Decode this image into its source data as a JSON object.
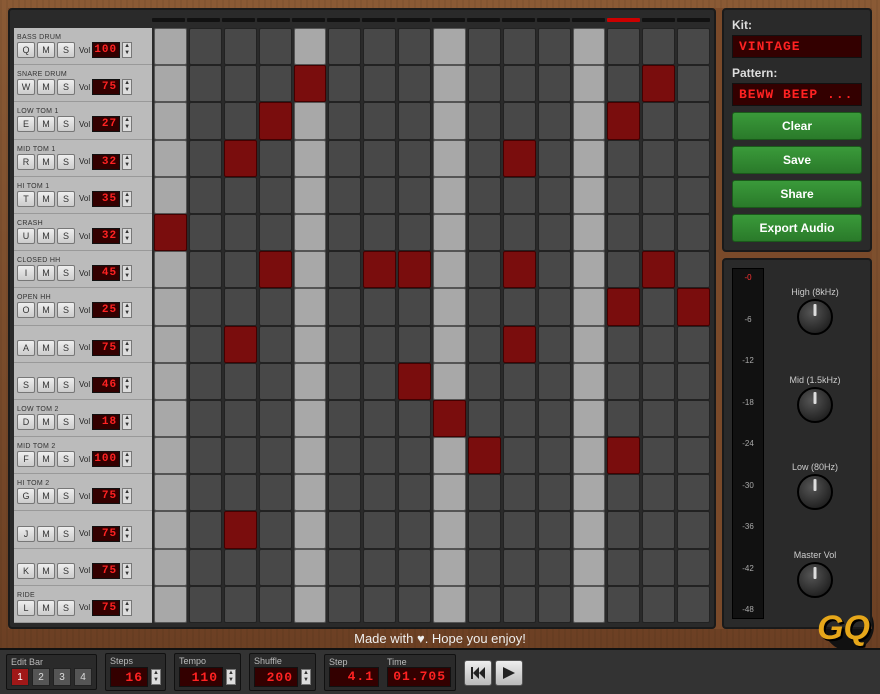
{
  "header_playing_step": 13,
  "tracks": [
    {
      "label": "BASS DRUM",
      "key": "Q",
      "vol": "100",
      "cellsOn": []
    },
    {
      "label": "SNARE DRUM",
      "key": "W",
      "vol": "75",
      "cellsOn": [
        4,
        14
      ]
    },
    {
      "label": "LOW TOM 1",
      "key": "E",
      "vol": "27",
      "cellsOn": [
        3,
        13
      ]
    },
    {
      "label": "MID TOM 1",
      "key": "R",
      "vol": "32",
      "cellsOn": [
        2,
        10
      ]
    },
    {
      "label": "HI TOM 1",
      "key": "T",
      "vol": "35",
      "cellsOn": []
    },
    {
      "label": "CRASH",
      "key": "U",
      "vol": "32",
      "cellsOn": [
        0
      ]
    },
    {
      "label": "CLOSED HH",
      "key": "I",
      "vol": "45",
      "cellsOn": [
        3,
        6,
        7,
        10,
        14
      ]
    },
    {
      "label": "OPEN HH",
      "key": "O",
      "vol": "25",
      "cellsOn": [
        13,
        15
      ]
    },
    {
      "label": "",
      "key": "A",
      "vol": "75",
      "cellsOn": [
        2,
        10
      ]
    },
    {
      "label": "",
      "key": "S",
      "vol": "46",
      "cellsOn": [
        7
      ]
    },
    {
      "label": "LOW TOM 2",
      "key": "D",
      "vol": "18",
      "cellsOn": [
        8
      ]
    },
    {
      "label": "MID TOM 2",
      "key": "F",
      "vol": "100",
      "cellsOn": [
        9,
        13
      ]
    },
    {
      "label": "HI TOM 2",
      "key": "G",
      "vol": "75",
      "cellsOn": []
    },
    {
      "label": "",
      "key": "J",
      "vol": "75",
      "cellsOn": [
        2
      ]
    },
    {
      "label": "",
      "key": "K",
      "vol": "75",
      "cellsOn": []
    },
    {
      "label": "RIDE",
      "key": "L",
      "vol": "75",
      "cellsOn": []
    }
  ],
  "track_btn_m": "M",
  "track_btn_s": "S",
  "vol_text": "Vol",
  "steps_per_row": 16,
  "kit_label": "Kit:",
  "kit_value": "VINTAGE",
  "pattern_label": "Pattern:",
  "pattern_value": "BEWW BEEP ...",
  "buttons": {
    "clear": "Clear",
    "save": "Save",
    "share": "Share",
    "export": "Export Audio"
  },
  "meter_ticks": [
    "-0",
    "-6",
    "-12",
    "-18",
    "-24",
    "-30",
    "-36",
    "-42",
    "-48"
  ],
  "knobs": [
    {
      "name": "high",
      "label": "High (8kHz)"
    },
    {
      "name": "mid",
      "label": "Mid (1.5kHz)"
    },
    {
      "name": "low",
      "label": "Low (80Hz)"
    },
    {
      "name": "master",
      "label": "Master Vol"
    }
  ],
  "footer_line": "Made with ♥. Hope you enjoy!",
  "edit_bar_label": "Edit Bar",
  "edit_bars": [
    "1",
    "2",
    "3",
    "4"
  ],
  "edit_bar_active": "1",
  "bb": {
    "steps_label": "Steps",
    "steps_value": "16",
    "tempo_label": "Tempo",
    "tempo_value": "110",
    "shuffle_label": "Shuffle",
    "shuffle_value": "200",
    "step_label": "Step",
    "step_value": "4.1",
    "time_label": "Time",
    "time_value": "01.705"
  },
  "logo": "GQ"
}
